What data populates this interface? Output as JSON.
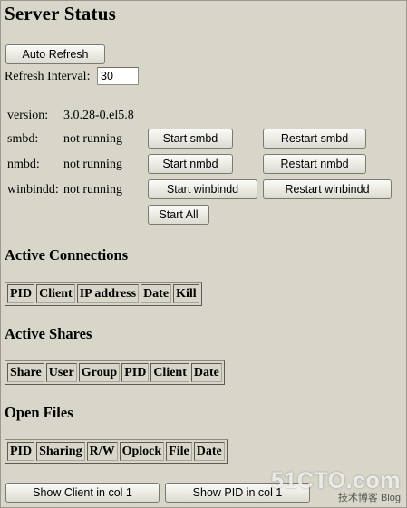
{
  "title": "Server Status",
  "refresh": {
    "auto_refresh_label": "Auto Refresh",
    "interval_label": "Refresh Interval:",
    "interval_value": "30"
  },
  "status": {
    "version_label": "version:",
    "version_value": "3.0.28-0.el5.8",
    "smbd": {
      "label": "smbd:",
      "state": "not running",
      "start_label": "Start smbd",
      "restart_label": "Restart smbd"
    },
    "nmbd": {
      "label": "nmbd:",
      "state": "not running",
      "start_label": "Start nmbd",
      "restart_label": "Restart nmbd"
    },
    "winbindd": {
      "label": "winbindd:",
      "state": "not running",
      "start_label": "Start winbindd",
      "restart_label": "Restart winbindd"
    },
    "start_all_label": "Start All"
  },
  "connections": {
    "heading": "Active Connections",
    "columns": [
      "PID",
      "Client",
      "IP address",
      "Date",
      "Kill"
    ]
  },
  "shares": {
    "heading": "Active Shares",
    "columns": [
      "Share",
      "User",
      "Group",
      "PID",
      "Client",
      "Date"
    ]
  },
  "files": {
    "heading": "Open Files",
    "columns": [
      "PID",
      "Sharing",
      "R/W",
      "Oplock",
      "File",
      "Date"
    ]
  },
  "footer": {
    "show_client_label": "Show Client in col 1",
    "show_pid_label": "Show PID in col 1"
  },
  "watermark": {
    "site": "51CTO.com",
    "tagline": "技术博客",
    "tag2": "Blog"
  }
}
